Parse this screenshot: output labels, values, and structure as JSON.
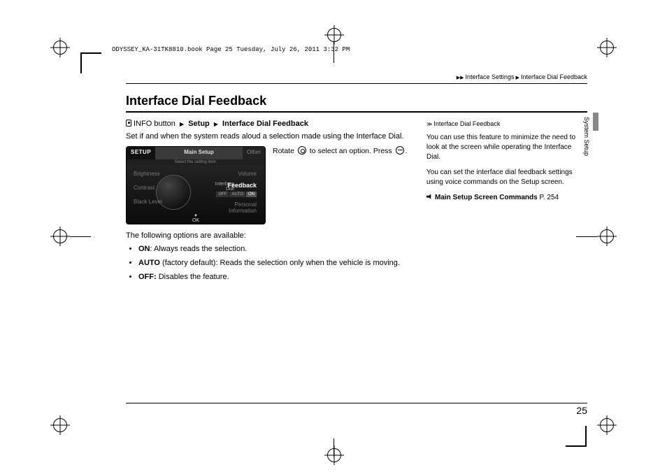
{
  "fileinfo": "ODYSSEY_KA-31TK8810.book  Page 25  Tuesday, July 26, 2011  3:32 PM",
  "breadcrumb": {
    "section": "Interface Settings",
    "page": "Interface Dial Feedback"
  },
  "title": "Interface Dial Feedback",
  "path": {
    "button": "INFO button",
    "step1": "Setup",
    "step2": "Interface Dial Feedback"
  },
  "lead": "Set if and when the system reads aloud a selection made using the Interface Dial.",
  "screenshot": {
    "setup_tab": "SETUP",
    "main_tab": "Main Setup",
    "other_tab": "Other",
    "subline": "Select the setting item.",
    "brightness": "Brightness",
    "contrast": "Contrast",
    "black": "Black Level",
    "volume": "Volume",
    "if_dial": "Interface\nDial",
    "feedback": "Feedback",
    "off": "OFF",
    "auto": "AUTO",
    "on": "ON",
    "personal": "Personal\nInformation",
    "ok": "OK"
  },
  "instruction": {
    "rotate": "Rotate",
    "select": "to select an option. Press",
    "end": "."
  },
  "options_intro": "The following options are available:",
  "options": [
    {
      "name": "ON",
      "desc": ": Always reads the selection."
    },
    {
      "name": "AUTO",
      "desc": " (factory default): Reads the selection only when the vehicle is moving."
    },
    {
      "name": "OFF:",
      "desc": " Disables the feature."
    }
  ],
  "sidebar": {
    "title": "Interface Dial Feedback",
    "p1": "You can use this feature to minimize the need to look at the screen while operating the Interface Dial.",
    "p2": "You can set the interface dial feedback settings using voice commands on the Setup screen.",
    "ref_label": "Main Setup Screen Commands",
    "ref_page": "P. 254",
    "tab": "System Setup"
  },
  "page_number": "25"
}
